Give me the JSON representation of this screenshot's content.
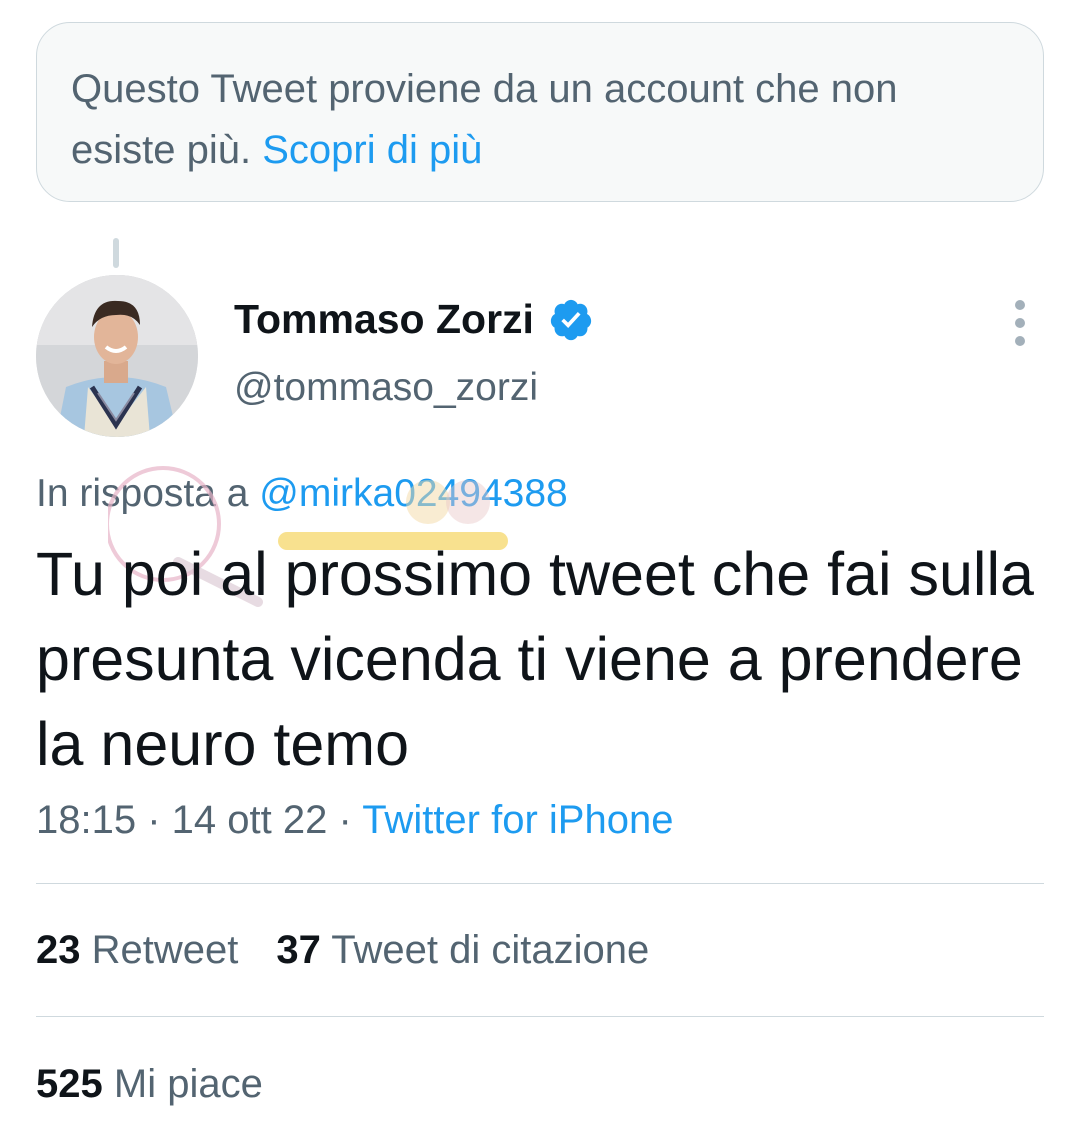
{
  "notice": {
    "text": "Questo Tweet proviene da un account che non esiste più.",
    "link": "Scopri di più"
  },
  "author": {
    "name": "Tommaso Zorzi",
    "handle": "@tommaso_zorzi",
    "verified": true,
    "verified_color": "#1d9bf0"
  },
  "reply": {
    "prefix": "In risposta a",
    "mention": "@mirka02494388"
  },
  "tweet": {
    "text": "Tu poi al prossimo tweet che fai sulla presunta vicenda ti viene a prendere la neuro temo"
  },
  "meta": {
    "time": "18:15",
    "date": "14 ott 22",
    "source": "Twitter for iPhone"
  },
  "stats": {
    "retweets": {
      "count": "23",
      "label": "Retweet"
    },
    "quotes": {
      "count": "37",
      "label": "Tweet di citazione"
    },
    "likes": {
      "count": "525",
      "label": "Mi piace"
    }
  },
  "colors": {
    "accent": "#1d9bf0",
    "secondary_text": "#536471",
    "primary_text": "#0f1419"
  }
}
